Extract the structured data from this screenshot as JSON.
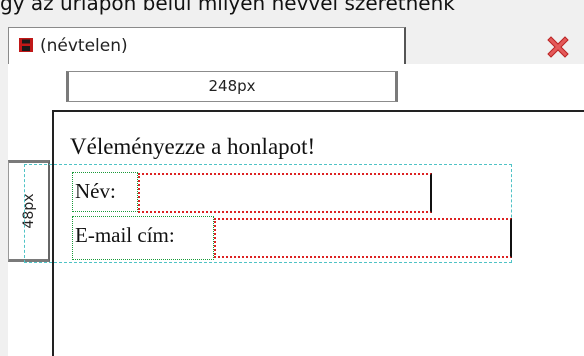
{
  "header_text": "gy az ürlapon belül milyen névvel szeretnénk",
  "tab": {
    "title": "(névtelen)",
    "icon": "save-disk-icon",
    "close_icon": "red-x-close-icon"
  },
  "rulers": {
    "width_label": "248px",
    "height_label": "48px"
  },
  "form": {
    "heading": "Véleményezze a honlapot!",
    "name_label": "Név:",
    "name_value": "",
    "email_label": "E-mail cím:",
    "email_value": ""
  },
  "colors": {
    "outer_guide": "#4fc3c6",
    "label_guide": "#1a9a3a",
    "input_guide": "#d22222",
    "close_red": "#d83a3a"
  }
}
